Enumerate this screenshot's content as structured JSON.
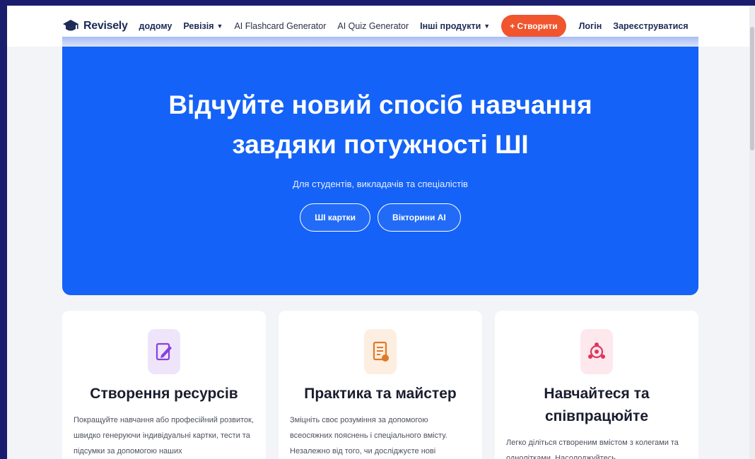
{
  "nav": {
    "brand": "Revisely",
    "links": [
      {
        "label": "додому",
        "caret": false,
        "style": "bold"
      },
      {
        "label": "Ревізія",
        "caret": true,
        "style": "bold"
      },
      {
        "label": "AI Flashcard Generator",
        "caret": false,
        "style": "light"
      },
      {
        "label": "AI Quiz Generator",
        "caret": false,
        "style": "light"
      },
      {
        "label": "Інші продукти",
        "caret": true,
        "style": "bold"
      }
    ],
    "create_label": "+ Створити",
    "login_label": "Логін",
    "signup_label": "Зареєструватися"
  },
  "hero": {
    "title_line1": "Відчуйте новий спосіб навчання",
    "title_line2": "завдяки потужності ШІ",
    "subtitle": "Для студентів, викладачів та спеціалістів",
    "btn_flashcards": "ШІ картки",
    "btn_quiz": "Вікторини AI"
  },
  "cards": [
    {
      "title": "Створення ресурсів",
      "text": "Покращуйте навчання або професійний розвиток, швидко генеруючи індивідуальні картки, тести та підсумки за допомогою наших",
      "icon": "edit-note-icon",
      "icon_bg": "#efe5fb",
      "icon_color": "#8a3fe0"
    },
    {
      "title": "Практика та майстер",
      "text": "Зміцніть своє розуміння за допомогою всеосяжних пояснень і спеціального вмісту. Незалежно від того, чи досліджуєте нові",
      "icon": "document-check-icon",
      "icon_bg": "#fdeee2",
      "icon_color": "#e07a26"
    },
    {
      "title_line1": "Навчайтеся та",
      "title_line2": "співпрацюйте",
      "text": "Легко діліться створеним вмістом з колегами та однолітками. Насолоджуйтесь",
      "icon": "share-collab-icon",
      "icon_bg": "#fde8ee",
      "icon_color": "#e0365a"
    }
  ],
  "colors": {
    "hero_blue": "#1462f7",
    "create_orange": "#f0552e",
    "outer_bg": "#1a1d6e"
  }
}
